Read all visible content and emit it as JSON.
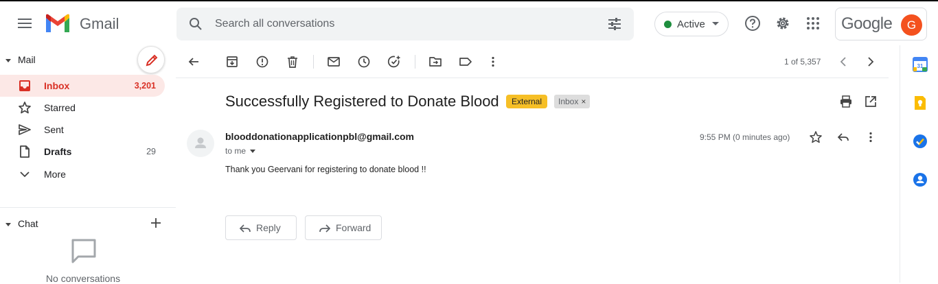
{
  "app": {
    "name": "Gmail"
  },
  "search": {
    "placeholder": "Search all conversations"
  },
  "status": {
    "label": "Active",
    "color": "#1e8e3e"
  },
  "account": {
    "brand": "Google",
    "avatar_letter": "G",
    "avatar_color": "#f4511e"
  },
  "sidebar": {
    "mail_header": "Mail",
    "items": [
      {
        "label": "Inbox",
        "count": "3,201",
        "icon": "inbox-icon"
      },
      {
        "label": "Starred",
        "count": "",
        "icon": "star-icon"
      },
      {
        "label": "Sent",
        "count": "",
        "icon": "sent-icon"
      },
      {
        "label": "Drafts",
        "count": "29",
        "icon": "draft-icon"
      },
      {
        "label": "More",
        "count": "",
        "icon": "chevron-down-icon"
      }
    ],
    "chat_header": "Chat",
    "no_conversations": "No conversations"
  },
  "toolbar": {
    "pager": "1 of 5,357"
  },
  "message": {
    "subject": "Successfully Registered to Donate Blood",
    "tags": {
      "external": "External",
      "inbox": "Inbox"
    },
    "sender": "blooddonationapplicationpbl@gmail.com",
    "to": "to me",
    "time": "9:55 PM (0 minutes ago)",
    "body": "Thank you Geervani for registering to donate blood !!"
  },
  "actions": {
    "reply": "Reply",
    "forward": "Forward"
  },
  "colors": {
    "accent_red": "#d93025",
    "active_bg": "#fce8e6",
    "external_tag": "#f6bf26"
  }
}
